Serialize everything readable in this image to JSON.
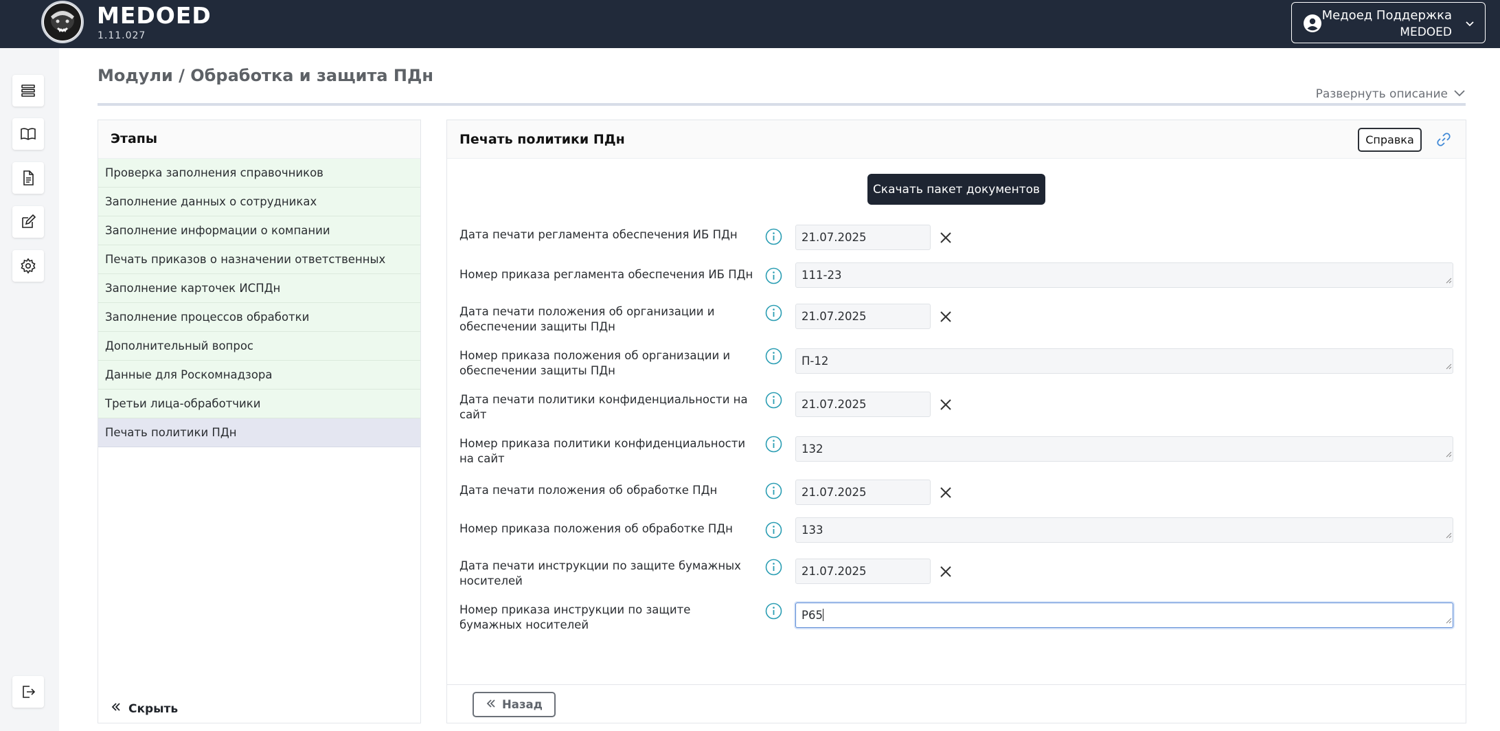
{
  "app": {
    "brand": "MEDOED",
    "version": "1.11.027",
    "user_name": "Медоед Поддержка",
    "user_org": "MEDOED"
  },
  "rail": {
    "icons": [
      "list-icon",
      "book-icon",
      "document-icon",
      "edit-icon",
      "settings-icon"
    ],
    "logout_icon": "logout-icon"
  },
  "page": {
    "title": "Модули / Обработка и защита ПДн",
    "expand_label": "Развернуть описание"
  },
  "stages": {
    "title": "Этапы",
    "items": [
      {
        "label": "Проверка заполнения справочников",
        "state": "done"
      },
      {
        "label": "Заполнение данных о сотрудниках",
        "state": "done"
      },
      {
        "label": "Заполнение информации о компании",
        "state": "done"
      },
      {
        "label": "Печать приказов о назначении ответственных",
        "state": "done"
      },
      {
        "label": "Заполнение карточек ИСПДн",
        "state": "done"
      },
      {
        "label": "Заполнение процессов обработки",
        "state": "done"
      },
      {
        "label": "Дополнительный вопрос",
        "state": "done"
      },
      {
        "label": "Данные для Роскомнадзора",
        "state": "done"
      },
      {
        "label": "Третьи лица-обработчики",
        "state": "done"
      },
      {
        "label": "Печать политики ПДн",
        "state": "active"
      }
    ],
    "hide_label": "Скрыть"
  },
  "form": {
    "title": "Печать политики ПДн",
    "help_label": "Справка",
    "download_label": "Скачать пакет документов",
    "fields": [
      {
        "label": "Дата печати регламента обеспечения ИБ ПДн",
        "value": "21.07.2025",
        "type": "date"
      },
      {
        "label": "Номер приказа регламента обеспечения ИБ ПДн",
        "value": "111-23",
        "type": "text"
      },
      {
        "label": "Дата печати положения об организации и обеспечении защиты ПДн",
        "value": "21.07.2025",
        "type": "date"
      },
      {
        "label": "Номер приказа положения об организации и обеспечении защиты ПДн",
        "value": "П-12",
        "type": "text"
      },
      {
        "label": "Дата печати политики конфиденциальности на сайт",
        "value": "21.07.2025",
        "type": "date"
      },
      {
        "label": "Номер приказа политики конфиденциальности на сайт",
        "value": "132",
        "type": "text"
      },
      {
        "label": "Дата печати положения об обработке ПДн",
        "value": "21.07.2025",
        "type": "date"
      },
      {
        "label": "Номер приказа положения об обработке ПДн",
        "value": "133",
        "type": "text"
      },
      {
        "label": "Дата печати инструкции по защите бумажных носителей",
        "value": "21.07.2025",
        "type": "date"
      },
      {
        "label": "Номер приказа инструкции по защите бумажных носителей",
        "value": "Р65",
        "type": "text",
        "focused": true
      }
    ],
    "back_label": "Назад"
  },
  "colors": {
    "topbar": "#212a3a",
    "stage_done_bg": "#edf9ee",
    "stage_active_bg": "#e4e6f1",
    "info_icon": "#2a9db3",
    "focus_border": "#5b8ad6"
  }
}
